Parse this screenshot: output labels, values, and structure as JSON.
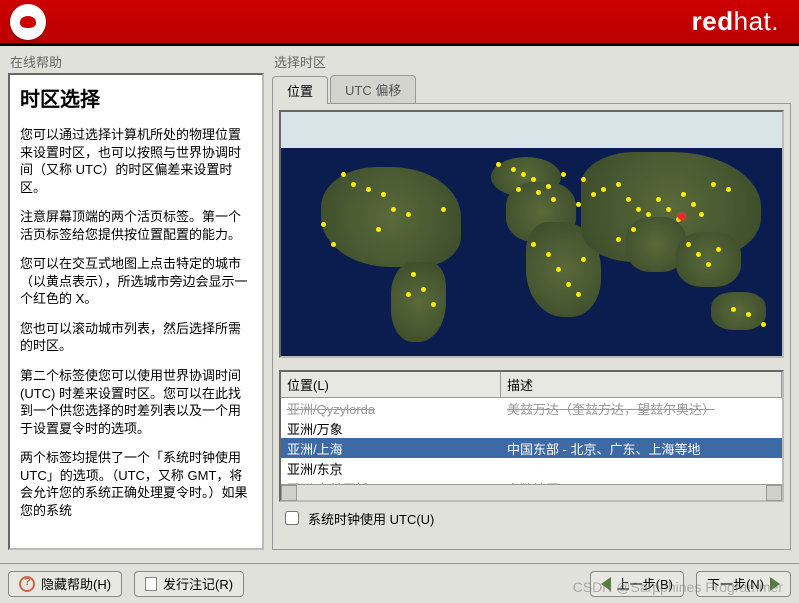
{
  "header": {
    "brand_bold": "red",
    "brand_light": "hat."
  },
  "help": {
    "label": "在线帮助",
    "title": "时区选择",
    "p1": "您可以通过选择计算机所处的物理位置来设置时区，也可以按照与世界协调时间（又称 UTC）的时区偏差来设置时区。",
    "p2": "注意屏幕顶端的两个活页标签。第一个活页标签给您提供按位置配置的能力。",
    "p3": "您可以在交互式地图上点击特定的城市（以黄点表示），所选城市旁边会显示一个红色的 X。",
    "p4": "您也可以滚动城市列表，然后选择所需的时区。",
    "p5": "第二个标签使您可以使用世界协调时间 (UTC) 时差来设置时区。您可以在此找到一个供您选择的时差列表以及一个用于设置夏令时的选项。",
    "p6": "两个标签均提供了一个「系统时钟使用 UTC」的选项。（UTC，又称 GMT，将会允许您的系统正确处理夏令时。）如果您的系统"
  },
  "right": {
    "label": "选择时区",
    "tabs": {
      "location": "位置",
      "utc_offset": "UTC 偏移"
    },
    "table": {
      "col_location": "位置(L)",
      "col_desc": "描述",
      "rows": [
        {
          "loc": "亚洲/Qyzylorda",
          "desc": "美玆万达（奎玆方达，望玆尔奥达）",
          "cut": true
        },
        {
          "loc": "亚洲/万象",
          "desc": ""
        },
        {
          "loc": "亚洲/上海",
          "desc": "中国东部 - 北京、广东、上海等地",
          "sel": true
        },
        {
          "loc": "亚洲/东京",
          "desc": ""
        },
        {
          "loc": "亚洲/乌兰巴托",
          "desc": "多数地区",
          "cut": true
        }
      ]
    },
    "checkbox": "系统时钟使用 UTC(U)"
  },
  "footer": {
    "hide_help": "隐藏帮助(H)",
    "release_notes": "发行注记(R)",
    "back": "上一步(B)",
    "next": "下一步(N)"
  },
  "watermark": "CSDN @Sarpphines Programmer"
}
